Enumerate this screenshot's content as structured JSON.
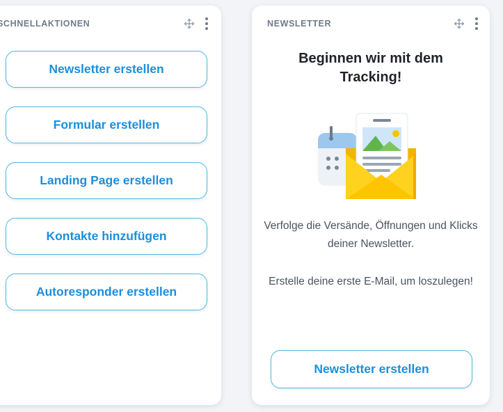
{
  "quick_actions": {
    "title": "Schnellaktionen",
    "move_icon": "move-icon",
    "menu_icon": "more-vertical-icon",
    "buttons": [
      {
        "label": "Newsletter erstellen"
      },
      {
        "label": "Formular erstellen"
      },
      {
        "label": "Landing Page erstellen"
      },
      {
        "label": "Kontakte hinzufügen"
      },
      {
        "label": "Autoresponder erstellen"
      }
    ]
  },
  "newsletter": {
    "title": "Newsletter",
    "move_icon": "move-icon",
    "menu_icon": "more-vertical-icon",
    "headline": "Beginnen wir mit dem Tracking!",
    "illustration_icon": "envelope-calendar-illustration",
    "text_1": "Verfolge die Versände, Öffnungen und Klicks deiner Newsletter.",
    "text_2": "Erstelle deine erste E-Mail, um loszulegen!",
    "cta_label": "Newsletter erstellen"
  },
  "colors": {
    "accent": "#1a8fdd",
    "button_border": "#4fb8e0",
    "background": "#f2f4f7",
    "card": "#ffffff",
    "muted_title": "#6f7b89"
  }
}
